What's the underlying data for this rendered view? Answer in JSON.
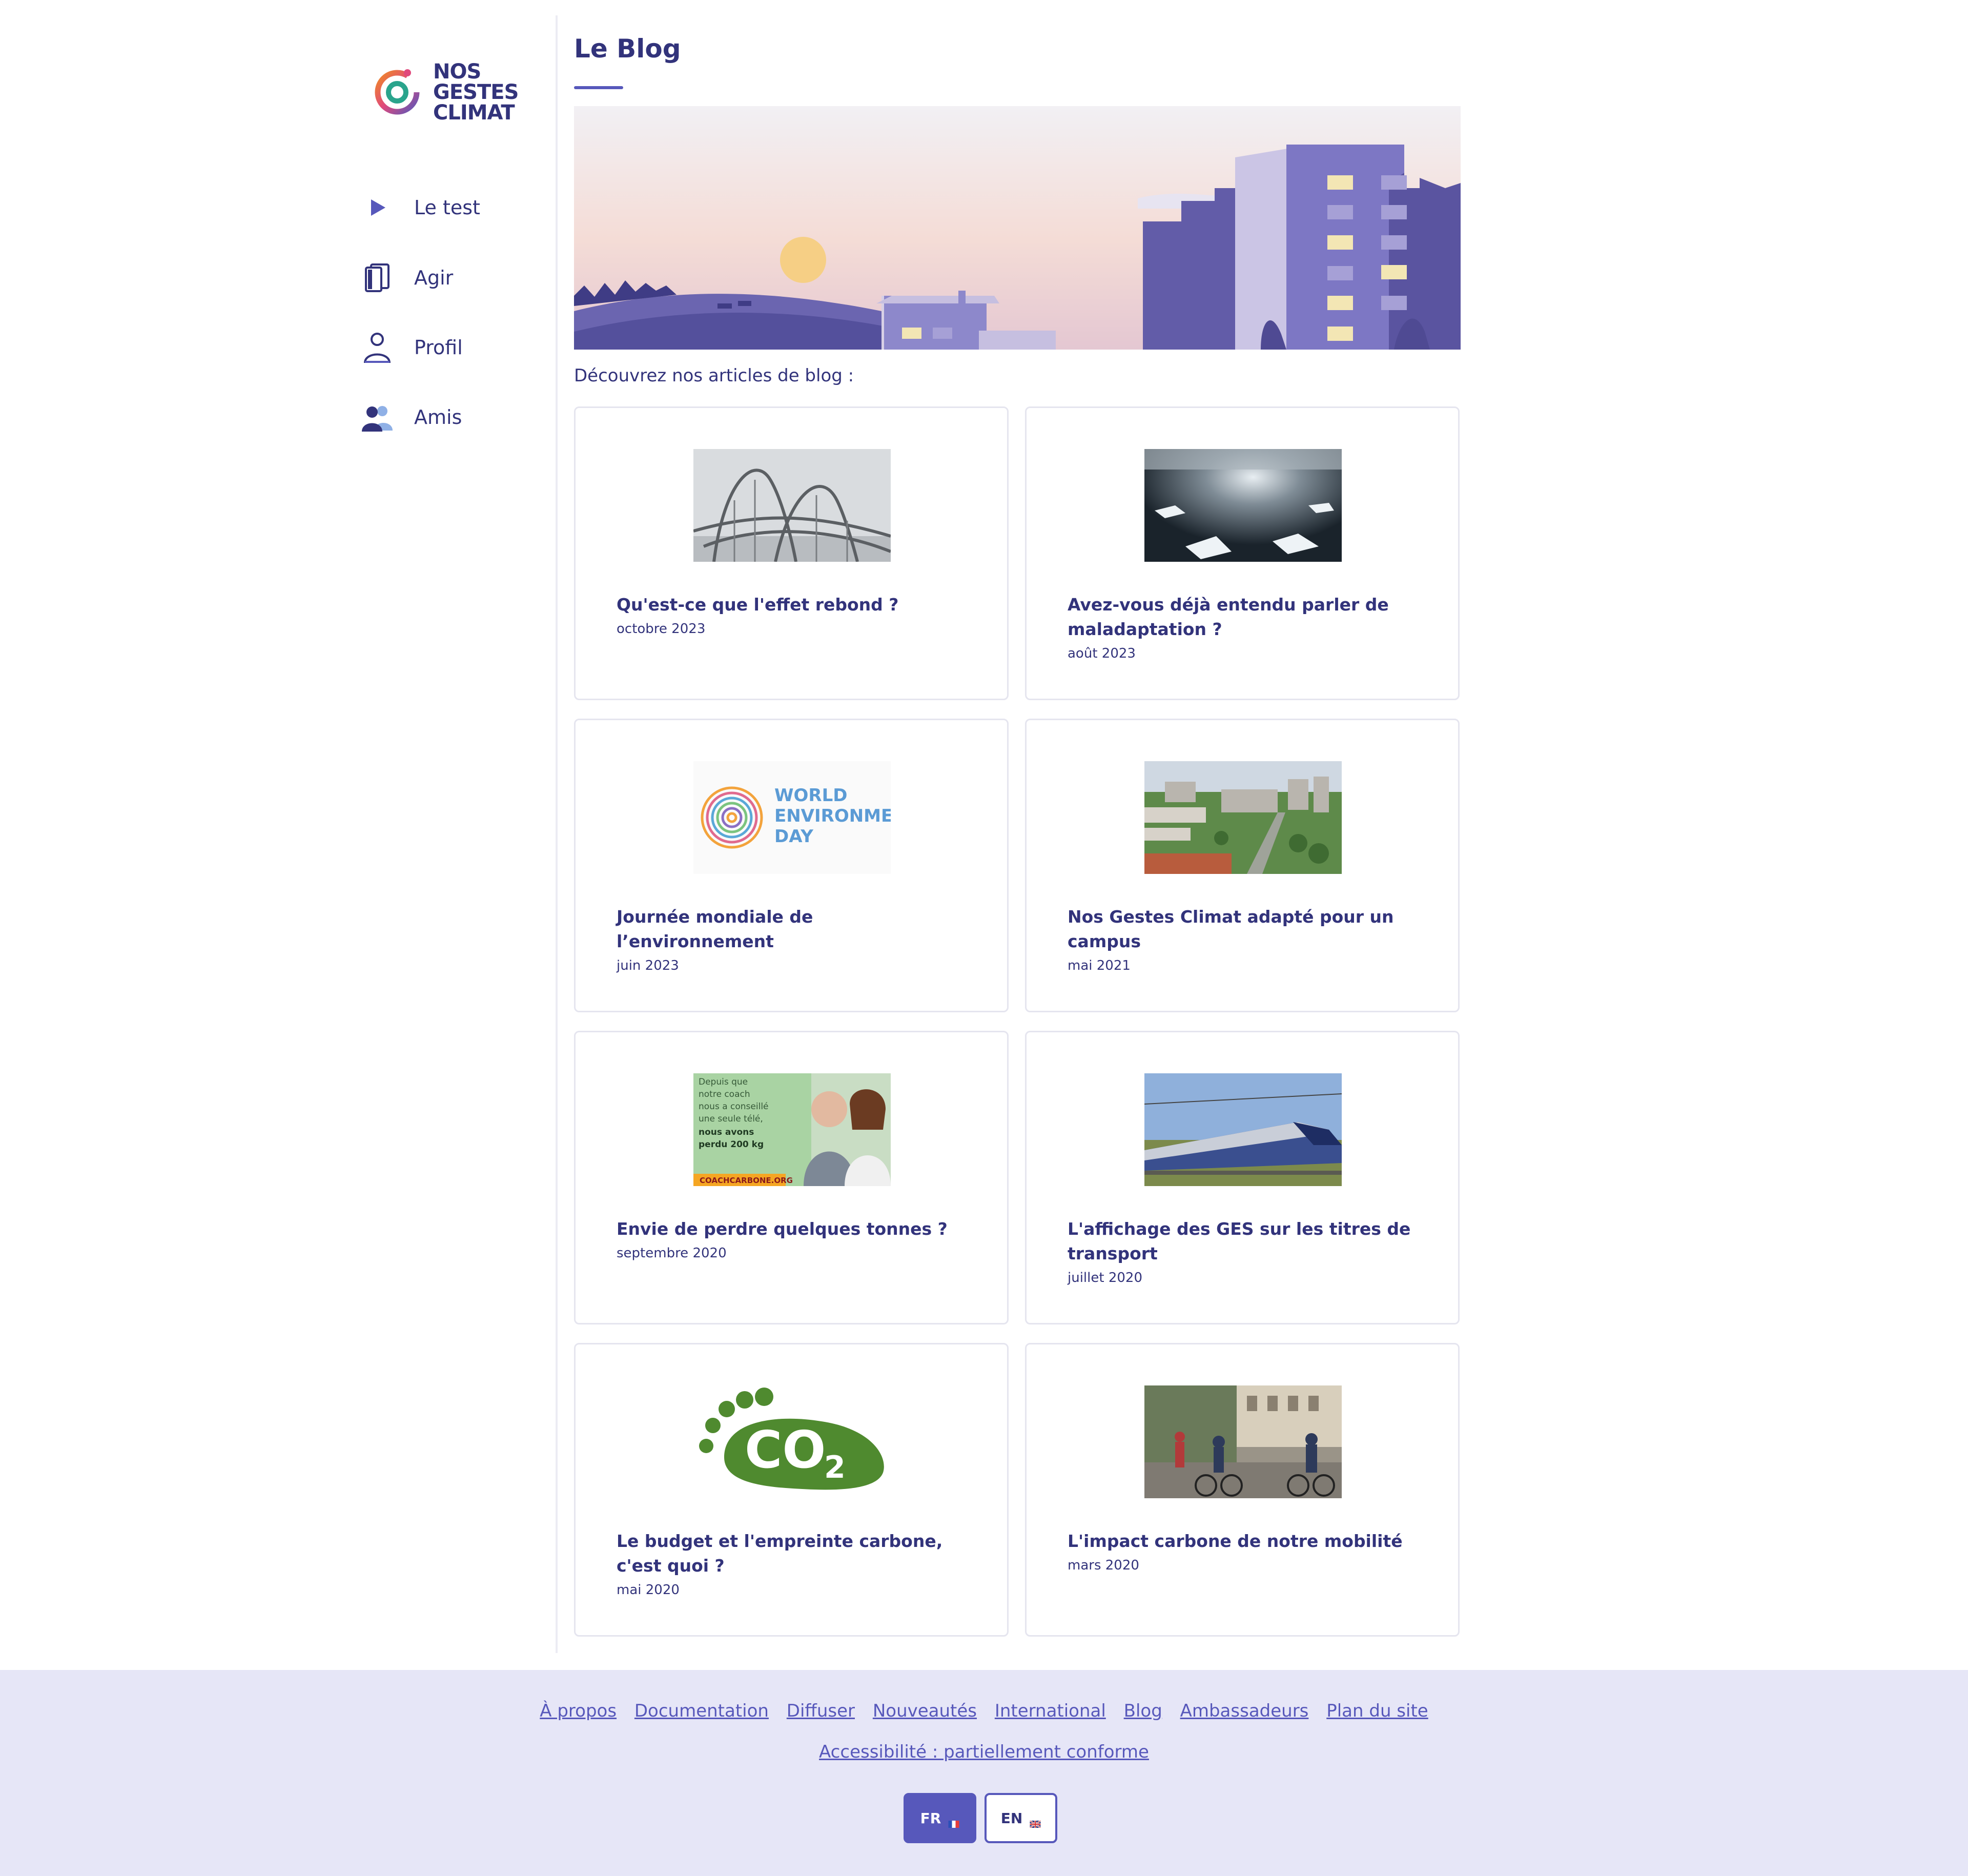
{
  "logo": {
    "text": "NOS\nGESTES\nCLIMAT"
  },
  "nav": {
    "items": [
      {
        "label": "Le test",
        "icon": "play-icon"
      },
      {
        "label": "Agir",
        "icon": "cards-icon"
      },
      {
        "label": "Profil",
        "icon": "person-icon"
      },
      {
        "label": "Amis",
        "icon": "group-icon"
      }
    ]
  },
  "page": {
    "title": "Le Blog",
    "intro": "Découvrez nos articles de blog :"
  },
  "articles": [
    {
      "title": "Qu'est-ce que l'effet rebond ?",
      "date": "octobre 2023",
      "image": "rollercoaster-photo"
    },
    {
      "title": "Avez-vous déjà entendu parler de maladaptation ?",
      "date": "août 2023",
      "image": "melting-ice-photo"
    },
    {
      "title": "Journée mondiale de l’environnement",
      "date": "juin 2023",
      "image": "world-environment-day-logo",
      "image_text": "WORLD\nENVIRONMENT\nDAY"
    },
    {
      "title": "Nos Gestes Climat adapté pour un campus",
      "date": "mai 2021",
      "image": "campus-aerial-photo"
    },
    {
      "title": "Envie de perdre quelques tonnes ?",
      "date": "septembre 2020",
      "image": "coach-carbone-ad",
      "image_text": "Depuis que\nnotre coach\nnous a conseillé\nune seule télé,\nnous avons\nperdu 200 kg",
      "image_brand": "COACHCARBONE.ORG"
    },
    {
      "title": "L'affichage des GES sur les titres de transport",
      "date": "juillet 2020",
      "image": "tgv-train-photo"
    },
    {
      "title": "Le budget et l'empreinte carbone, c'est quoi ?",
      "date": "mai 2020",
      "image": "co2-footprint-grass",
      "image_text": "CO2"
    },
    {
      "title": "L'impact carbone de notre mobilité",
      "date": "mars 2020",
      "image": "cyclists-street-photo"
    }
  ],
  "footer": {
    "links": [
      "À propos",
      "Documentation",
      "Diffuser",
      "Nouveautés",
      "International",
      "Blog",
      "Ambassadeurs",
      "Plan du site"
    ],
    "accessibility": "Accessibilité : partiellement conforme",
    "languages": [
      {
        "code": "FR",
        "active": true
      },
      {
        "code": "EN",
        "active": false
      }
    ]
  },
  "colors": {
    "primary": "#5758bb",
    "text": "#32337b",
    "footer_bg": "#e6e6f7"
  }
}
